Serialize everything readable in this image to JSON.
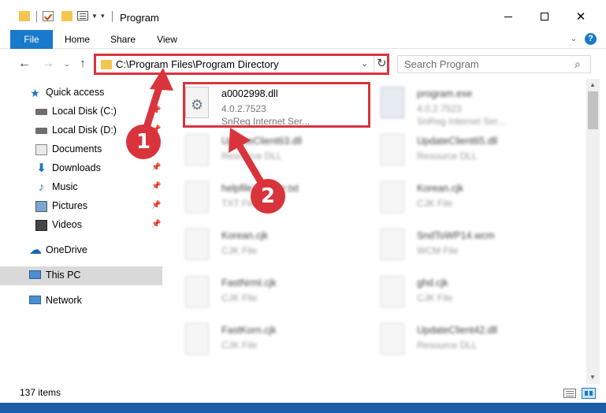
{
  "window": {
    "title": "Program"
  },
  "ribbon": {
    "file": "File",
    "home": "Home",
    "share": "Share",
    "view": "View",
    "help": "?"
  },
  "address": {
    "path": "C:\\Program Files\\Program Directory",
    "search_placeholder": "Search Program"
  },
  "sidebar": {
    "items": [
      {
        "label": "Quick access"
      },
      {
        "label": "Local Disk (C:)"
      },
      {
        "label": "Local Disk (D:)"
      },
      {
        "label": "Documents"
      },
      {
        "label": "Downloads"
      },
      {
        "label": "Music"
      },
      {
        "label": "Pictures"
      },
      {
        "label": "Videos"
      },
      {
        "label": "OneDrive"
      },
      {
        "label": "This PC"
      },
      {
        "label": "Network"
      }
    ]
  },
  "files": [
    {
      "name": "a0002998.dll",
      "sub1": "4.0.2.7523",
      "sub2": "SnReg Internet Ser..."
    },
    {
      "name": "program.exe",
      "sub1": "4.0.2.7523",
      "sub2": "SnReg Internet Ser..."
    },
    {
      "name": "UpdateClient63.dll",
      "sub1": "Resource DLL",
      "sub2": ""
    },
    {
      "name": "UpdateClient65.dll",
      "sub1": "Resource DLL",
      "sub2": ""
    },
    {
      "name": "helpfile.header.txt",
      "sub1": "TXT File",
      "sub2": ""
    },
    {
      "name": "Korean.cjk",
      "sub1": "CJK File",
      "sub2": ""
    },
    {
      "name": "Korean.cjk",
      "sub1": "CJK File",
      "sub2": ""
    },
    {
      "name": "SndToWP14.wcm",
      "sub1": "WCM File",
      "sub2": ""
    },
    {
      "name": "FastNrml.cjk",
      "sub1": "CJK File",
      "sub2": ""
    },
    {
      "name": "ghd.cjk",
      "sub1": "CJK File",
      "sub2": ""
    },
    {
      "name": "FastKorn.cjk",
      "sub1": "CJK File",
      "sub2": ""
    },
    {
      "name": "UpdateClient42.dll",
      "sub1": "Resource DLL",
      "sub2": ""
    }
  ],
  "status": {
    "count": "137 items"
  },
  "annotations": {
    "step1": "1",
    "step2": "2",
    "color": "#d9343c"
  }
}
